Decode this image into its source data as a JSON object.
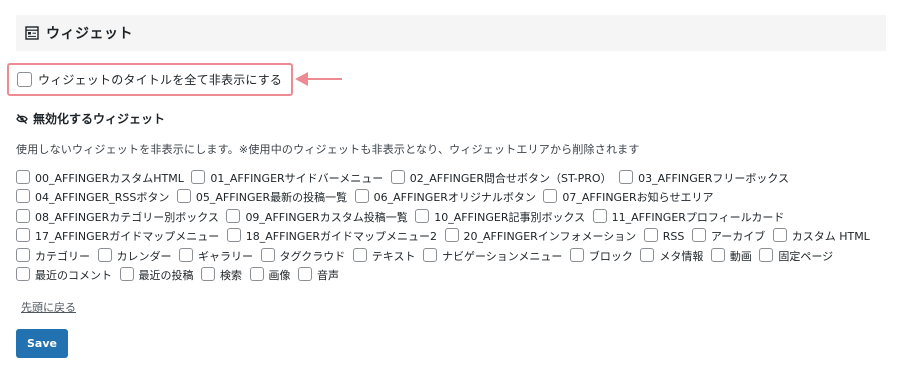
{
  "section": {
    "title": "ウィジェット",
    "icon": "widget-list-icon"
  },
  "hide_titles": {
    "label": "ウィジェットのタイトルを全て非表示にする",
    "checked": false
  },
  "highlight": {
    "border_color": "#ee8a91",
    "arrow_color": "#ee8a91"
  },
  "disabled_widgets": {
    "heading": "無効化するウィジェット",
    "heading_icon": "eye-slash-icon",
    "description": "使用しないウィジェットを非表示にします。※使用中のウィジェットも非表示となり、ウィジェットエリアから削除されます",
    "items": [
      {
        "label": "00_AFFINGERカスタムHTML",
        "checked": false
      },
      {
        "label": "01_AFFINGERサイドバーメニュー",
        "checked": false
      },
      {
        "label": "02_AFFINGER問合せボタン（ST-PRO）",
        "checked": false
      },
      {
        "label": "03_AFFINGERフリーボックス",
        "checked": false
      },
      {
        "label": "04_AFFINGER_RSSボタン",
        "checked": false
      },
      {
        "label": "05_AFFINGER最新の投稿一覧",
        "checked": false
      },
      {
        "label": "06_AFFINGERオリジナルボタン",
        "checked": false
      },
      {
        "label": "07_AFFINGERお知らせエリア",
        "checked": false
      },
      {
        "label": "08_AFFINGERカテゴリー別ボックス",
        "checked": false
      },
      {
        "label": "09_AFFINGERカスタム投稿一覧",
        "checked": false
      },
      {
        "label": "10_AFFINGER記事別ボックス",
        "checked": false
      },
      {
        "label": "11_AFFINGERプロフィールカード",
        "checked": false
      },
      {
        "label": "17_AFFINGERガイドマップメニュー",
        "checked": false
      },
      {
        "label": "18_AFFINGERガイドマップメニュー2",
        "checked": false
      },
      {
        "label": "20_AFFINGERインフォメーション",
        "checked": false
      },
      {
        "label": "RSS",
        "checked": false
      },
      {
        "label": "アーカイブ",
        "checked": false
      },
      {
        "label": "カスタム HTML",
        "checked": false
      },
      {
        "label": "カテゴリー",
        "checked": false
      },
      {
        "label": "カレンダー",
        "checked": false
      },
      {
        "label": "ギャラリー",
        "checked": false
      },
      {
        "label": "タグクラウド",
        "checked": false
      },
      {
        "label": "テキスト",
        "checked": false
      },
      {
        "label": "ナビゲーションメニュー",
        "checked": false
      },
      {
        "label": "ブロック",
        "checked": false
      },
      {
        "label": "メタ情報",
        "checked": false
      },
      {
        "label": "動画",
        "checked": false
      },
      {
        "label": "固定ページ",
        "checked": false
      },
      {
        "label": "最近のコメント",
        "checked": false
      },
      {
        "label": "最近の投稿",
        "checked": false
      },
      {
        "label": "検索",
        "checked": false
      },
      {
        "label": "画像",
        "checked": false
      },
      {
        "label": "音声",
        "checked": false
      }
    ]
  },
  "back_to_top": "先頭に戻る",
  "save_button": {
    "label": "Save",
    "color": "#2271b1"
  }
}
